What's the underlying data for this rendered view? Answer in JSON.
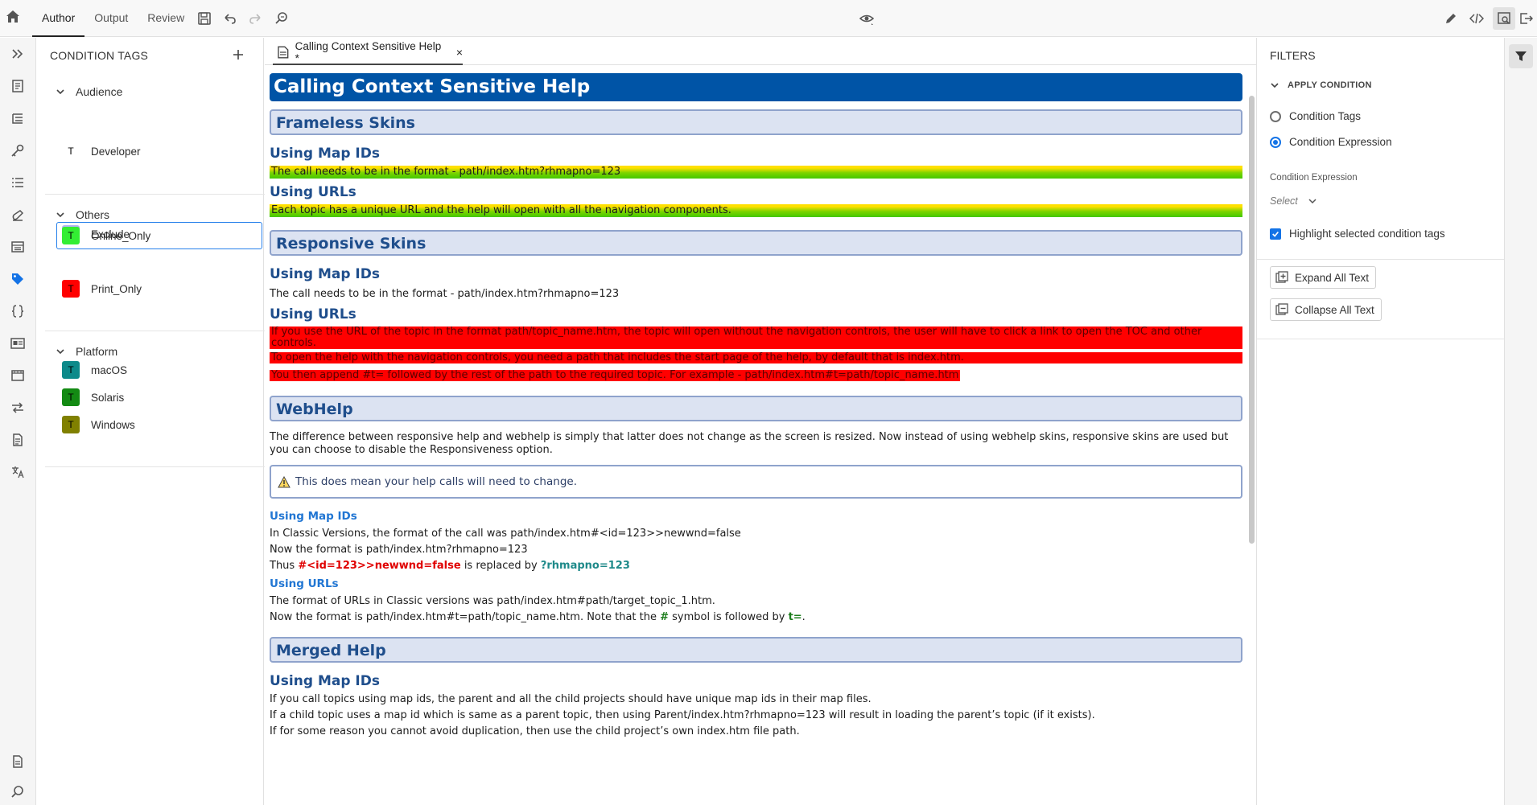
{
  "topbar": {
    "tabs": [
      {
        "label": "Author"
      },
      {
        "label": "Output"
      },
      {
        "label": "Review"
      }
    ]
  },
  "condition_tags": {
    "title": "CONDITION TAGS",
    "groups": [
      {
        "label": "Audience",
        "tags": [
          {
            "letter": "T",
            "label": "Developer",
            "color": "#ffffff"
          }
        ]
      },
      {
        "label": "Others",
        "tags": [
          {
            "letter": "T",
            "label": "Exclude",
            "color": "#b3b3f2"
          },
          {
            "letter": "T",
            "label": "Online_Only",
            "color": "#33ee33"
          },
          {
            "letter": "T",
            "label": "Print_Only",
            "color": "#ff0000"
          }
        ]
      },
      {
        "label": "Platform",
        "tags": [
          {
            "letter": "T",
            "label": "macOS",
            "color": "#0d8a8a"
          },
          {
            "letter": "T",
            "label": "Solaris",
            "color": "#138a13"
          },
          {
            "letter": "T",
            "label": "Windows",
            "color": "#808000"
          }
        ]
      }
    ]
  },
  "editor": {
    "tab_label": "Calling Context Sensitive Help *",
    "close_glyph": "×",
    "doc": {
      "title": "Calling Context Sensitive Help",
      "frameless": {
        "heading": "Frameless Skins",
        "map_ids_heading": "Using Map IDs",
        "map_ids_text": "The call needs to be in the format - path/index.htm?rhmapno=123",
        "urls_heading": "Using URLs",
        "urls_text": "Each topic has a unique URL and the help will open with all the navigation components."
      },
      "responsive": {
        "heading": "Responsive Skins",
        "map_ids_heading": "Using Map IDs",
        "map_ids_text": "The call needs to be in the format - path/index.htm?rhmapno=123",
        "urls_heading": "Using URLs",
        "red1": "If you use the URL of the topic in the format path/topic_name.htm, the topic will open without the navigation controls, the user will have to click a link to open the TOC and other controls.",
        "red2": "To open the help with the navigation controls, you need a path that includes the start page of the help, by default that is index.htm.",
        "red3": "You then append #t= followed by the rest of the path to the required topic. For example - path/index.htm#t=path/topic_name.htm"
      },
      "webhelp": {
        "heading": "WebHelp",
        "intro": "The difference between responsive help and webhelp is simply that latter does not change as the screen is resized. Now instead of using webhelp skins, responsive skins are used but you can choose to disable the Responsiveness option.",
        "note": "This does mean your help calls will need to change.",
        "map_ids_heading": "Using Map IDs",
        "classic_call": "In Classic Versions, the format of the call was path/index.htm#<id=123>>newwnd=false",
        "now_call": "Now the format is path/index.htm?rhmapno=123",
        "thus_prefix": "Thus ",
        "thus_old": "#<id=123>>newwnd=false",
        "thus_mid": " is replaced by ",
        "thus_new": "?rhmapno=123",
        "urls_heading": "Using URLs",
        "urls_classic": "The format of URLs in Classic versions was path/index.htm#path/target_topic_1.htm.",
        "urls_now_prefix": "Now the format is path/index.htm#t=path/topic_name.htm. Note that the ",
        "urls_hash": "#",
        "urls_mid": " symbol is followed by ",
        "urls_t": "t=",
        "urls_end": "."
      },
      "merged": {
        "heading": "Merged Help",
        "map_ids_heading": "Using Map IDs",
        "p1": "If you call topics using map ids, the parent and all the child projects should have unique map ids in their map files.",
        "p2": "If a child topic uses a map id which is same as a parent topic, then using Parent/index.htm?rhmapno=123 will result in loading the parent’s topic (if it exists).",
        "p3": "If for some reason you cannot avoid duplication, then use the child project’s own index.htm file path."
      }
    }
  },
  "filters": {
    "title": "FILTERS",
    "apply_condition": "APPLY CONDITION",
    "radio_tags": "Condition Tags",
    "radio_expression": "Condition Expression",
    "selected_radio": "Condition Expression",
    "expression_label": "Condition Expression",
    "select_value": "Select",
    "highlight_label": "Highlight selected condition tags",
    "highlight_checked": true,
    "expand_label": "Expand All Text",
    "collapse_label": "Collapse All Text"
  },
  "colors": {
    "accent": "#1473e6",
    "heading_blue": "#0054a6",
    "section_bg": "#dce3f2"
  }
}
